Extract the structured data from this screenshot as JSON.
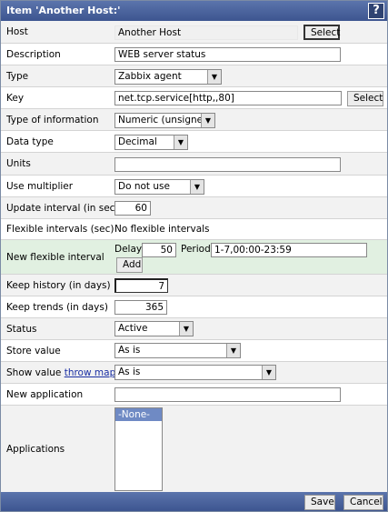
{
  "window": {
    "title": "Item 'Another Host:'",
    "help": "?"
  },
  "host": {
    "label": "Host",
    "value": "Another Host",
    "button": "Select"
  },
  "description": {
    "label": "Description",
    "value": "WEB server status"
  },
  "type": {
    "label": "Type",
    "value": "Zabbix agent"
  },
  "key": {
    "label": "Key",
    "value": "net.tcp.service[http,,80]",
    "button": "Select"
  },
  "type_of_information": {
    "label": "Type of information",
    "value": "Numeric (unsigned)"
  },
  "data_type": {
    "label": "Data type",
    "value": "Decimal"
  },
  "units": {
    "label": "Units",
    "value": ""
  },
  "use_multiplier": {
    "label": "Use multiplier",
    "value": "Do not use"
  },
  "update_interval": {
    "label": "Update interval (in sec)",
    "value": "60"
  },
  "flexible_intervals": {
    "label": "Flexible intervals (sec)",
    "value": "No flexible intervals"
  },
  "new_flexible_interval": {
    "label": "New flexible interval",
    "delay_label": "Delay",
    "delay_value": "50",
    "period_label": "Period",
    "period_value": "1-7,00:00-23:59",
    "add_button": "Add"
  },
  "keep_history": {
    "label": "Keep history (in days)",
    "value": "7"
  },
  "keep_trends": {
    "label": "Keep trends (in days)",
    "value": "365"
  },
  "status": {
    "label": "Status",
    "value": "Active"
  },
  "store_value": {
    "label": "Store value",
    "value": "As is"
  },
  "show_value": {
    "label": "Show value",
    "link": "throw map",
    "value": "As is"
  },
  "new_application": {
    "label": "New application",
    "value": ""
  },
  "applications": {
    "label": "Applications",
    "options": [
      "-None-"
    ]
  },
  "footer": {
    "save": "Save",
    "cancel": "Cancel"
  },
  "colors": {
    "title_bar": "#3d5590",
    "flexible_row": "#e1f0e1",
    "selected_option": "#6f8ac4",
    "link": "#1a2fa3"
  }
}
